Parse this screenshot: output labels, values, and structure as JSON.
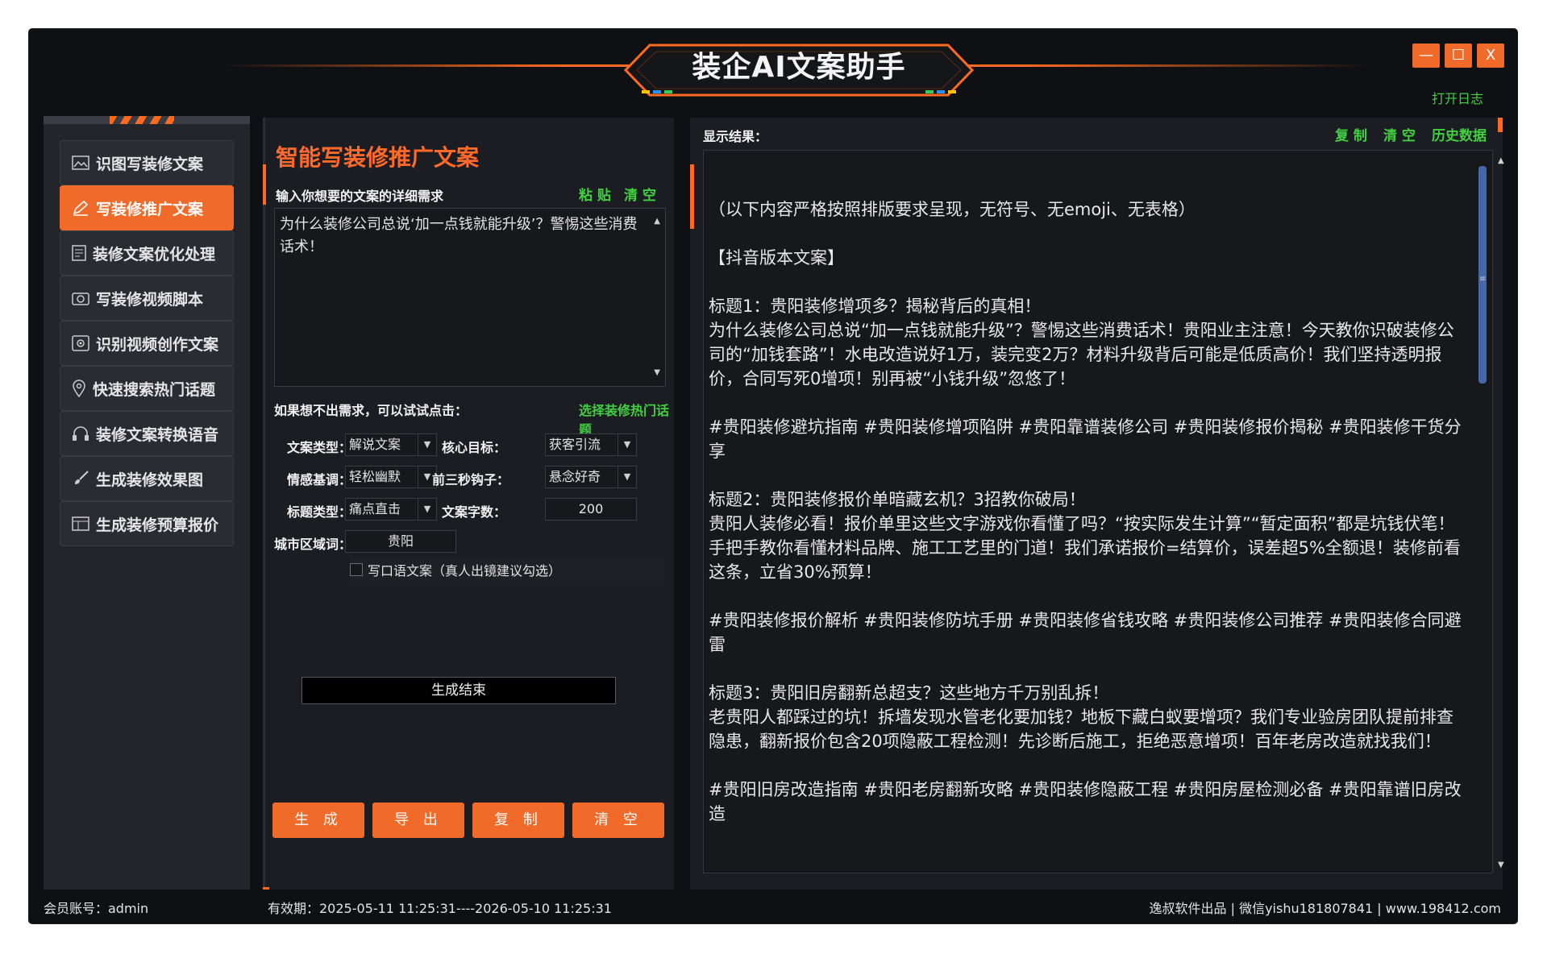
{
  "window": {
    "title": "装企AI文案助手",
    "minimize_glyph": "—",
    "maximize_glyph": "☐",
    "close_glyph": "X",
    "open_log": "打开日志",
    "accent_color": "#f06a2a",
    "link_color": "#40d040"
  },
  "sidebar": {
    "items": [
      {
        "label": "识图写装修文案",
        "icon": "image-icon"
      },
      {
        "label": "写装修推广文案",
        "icon": "pen-icon",
        "active": true
      },
      {
        "label": "装修文案优化处理",
        "icon": "document-icon"
      },
      {
        "label": "写装修视频脚本",
        "icon": "camera-icon"
      },
      {
        "label": "识别视频创作文案",
        "icon": "video-gear-icon"
      },
      {
        "label": "快速搜索热门话题",
        "icon": "location-pin-icon"
      },
      {
        "label": "装修文案转换语音",
        "icon": "headphones-icon"
      },
      {
        "label": "生成装修效果图",
        "icon": "paint-brush-icon"
      },
      {
        "label": "生成装修预算报价",
        "icon": "budget-table-icon"
      }
    ]
  },
  "mid": {
    "heading": "智能写装修推广文案",
    "input_label": "输入你想要的文案的详细需求",
    "paste": "粘 贴",
    "clear": "清 空",
    "request_text": "为什么装修公司总说‘加一点钱就能升级’？警惕这些消费话术！",
    "hint": "如果想不出需求，可以试试点击：",
    "hint_link": "选择装修热门话题",
    "fields": {
      "copy_type_label": "文案类型：",
      "copy_type_value": "解说文案",
      "core_goal_label": "核心目标：",
      "core_goal_value": "获客引流",
      "tone_label": "情感基调：",
      "tone_value": "轻松幽默",
      "hook_label": "前三秒钩子：",
      "hook_value": "悬念好奇",
      "title_type_label": "标题类型：",
      "title_type_value": "痛点直击",
      "word_count_label": "文案字数：",
      "word_count_value": "200",
      "city_label": "城市区域词：",
      "city_value": "贵阳"
    },
    "oral_checkbox": "写口语文案（真人出镜建议勾选）",
    "status": "生成结束",
    "buttons": {
      "generate": "生 成",
      "export": "导 出",
      "copy": "复 制",
      "clear": "清 空"
    }
  },
  "right": {
    "label": "显示结果：",
    "copy": "复 制",
    "clear": "清 空",
    "history": "历史数据",
    "result_text": "（以下内容严格按照排版要求呈现，无符号、无emoji、无表格）\n\n【抖音版本文案】\n\n标题1：贵阳装修增项多？揭秘背后的真相！\n为什么装修公司总说“加一点钱就能升级”？警惕这些消费话术！贵阳业主注意！今天教你识破装修公司的“加钱套路”！水电改造说好1万，装完变2万？材料升级背后可能是低质高价！我们坚持透明报价，合同写死0增项！别再被“小钱升级”忽悠了！\n\n#贵阳装修避坑指南 #贵阳装修增项陷阱 #贵阳靠谱装修公司 #贵阳装修报价揭秘 #贵阳装修干货分享\n\n标题2：贵阳装修报价单暗藏玄机？3招教你破局！\n贵阳人装修必看！报价单里这些文字游戏你看懂了吗？“按实际发生计算”“暂定面积”都是坑钱伏笔！手把手教你看懂材料品牌、施工工艺里的门道！我们承诺报价=结算价，误差超5%全额退！装修前看这条，立省30%预算！\n\n#贵阳装修报价解析 #贵阳装修防坑手册 #贵阳装修省钱攻略 #贵阳装修公司推荐 #贵阳装修合同避雷\n\n标题3：贵阳旧房翻新总超支？这些地方千万别乱拆！\n老贵阳人都踩过的坑！拆墙发现水管老化要加钱？地板下藏白蚁要增项？我们专业验房团队提前排查隐患，翻新报价包含20项隐蔽工程检测！先诊断后施工，拒绝恶意增项！百年老房改造就找我们！\n\n#贵阳旧房改造指南 #贵阳老房翻新攻略 #贵阳装修隐蔽工程 #贵阳房屋检测必备 #贵阳靠谱旧房改造"
  },
  "footer": {
    "account": "会员账号：admin",
    "validity": "有效期：2025-05-11 11:25:31----2026-05-10 11:25:31",
    "credits": "逸叔软件出品 | 微信yishu181807841 | www.198412.com"
  }
}
